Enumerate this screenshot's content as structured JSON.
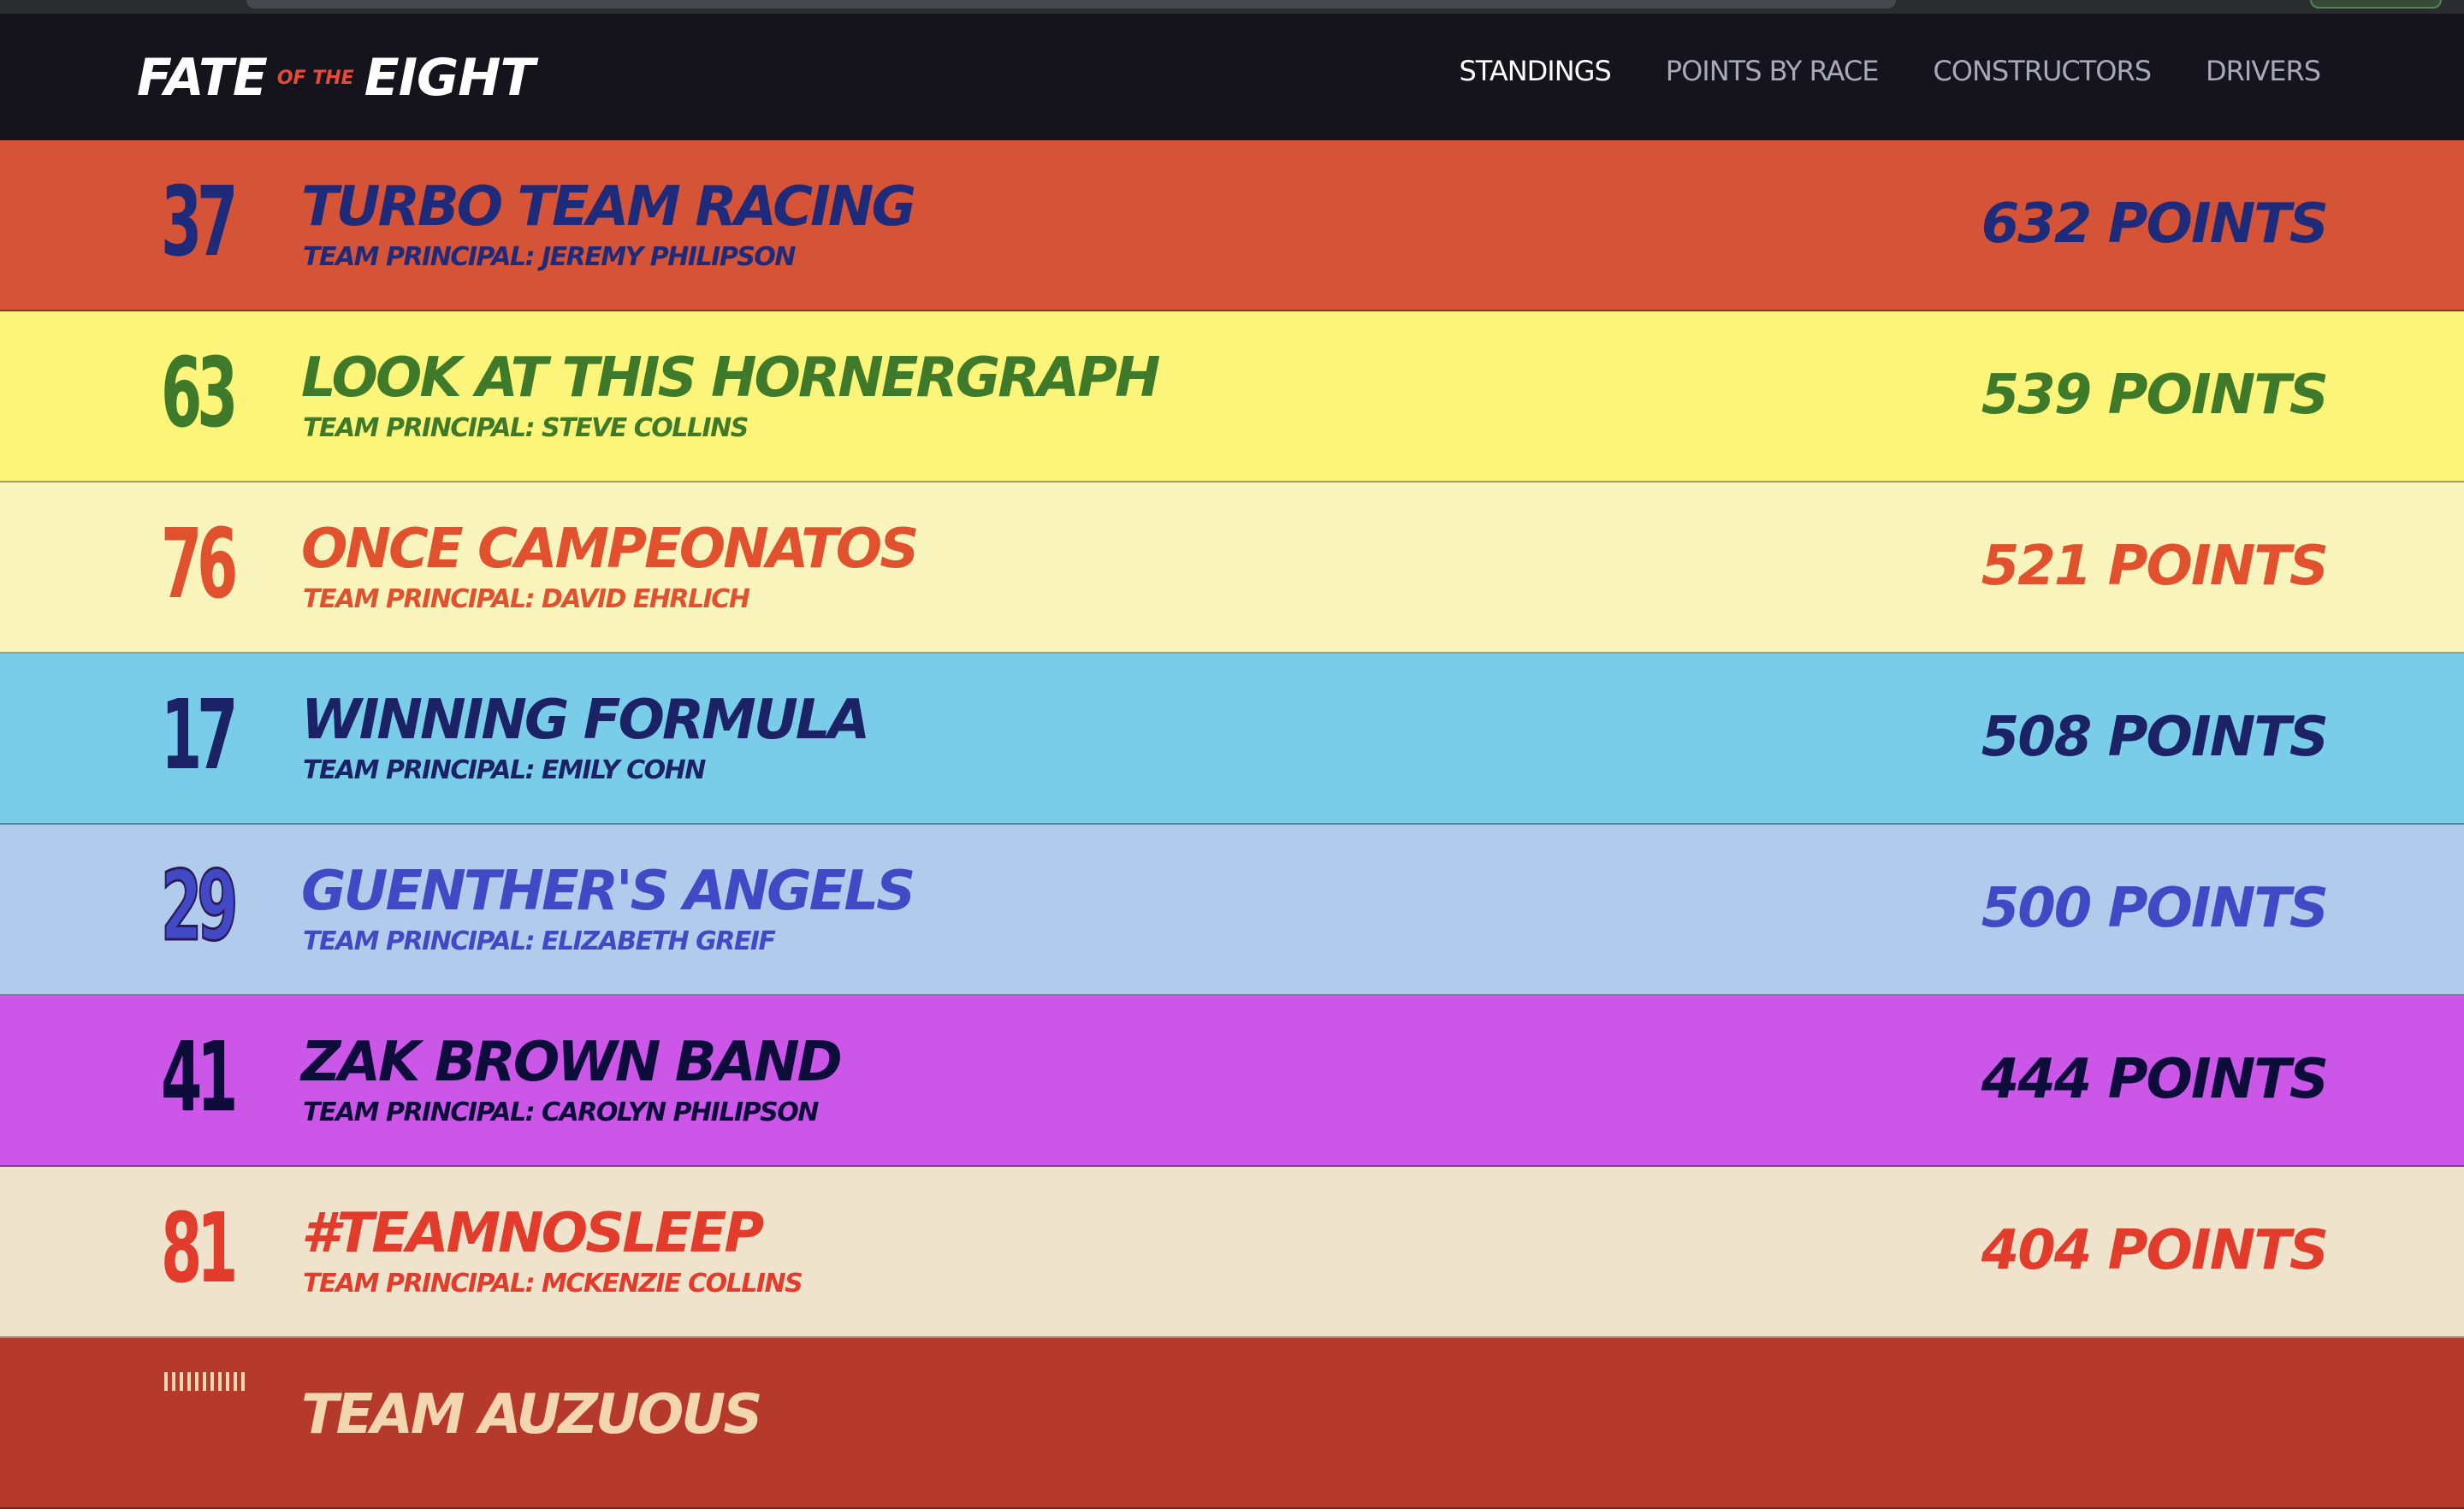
{
  "header": {
    "logo": {
      "word1": "FATE",
      "connector": "OF THE",
      "word2": "EIGHT"
    },
    "nav": [
      {
        "label": "STANDINGS",
        "active": true
      },
      {
        "label": "POINTS BY RACE",
        "active": false
      },
      {
        "label": "CONSTRUCTORS",
        "active": false
      },
      {
        "label": "DRIVERS",
        "active": false
      }
    ]
  },
  "standings": [
    {
      "number": "37",
      "team": "TURBO TEAM RACING",
      "principal": "TEAM PRINCIPAL: JEREMY PHILIPSON",
      "points": "632 POINTS",
      "bg": "#d55336",
      "fg": "#1e2b7a",
      "outline": false
    },
    {
      "number": "63",
      "team": "LOOK AT THIS HORNERGRAPH",
      "principal": "TEAM PRINCIPAL: STEVE COLLINS",
      "points": "539 POINTS",
      "bg": "#fcf57a",
      "fg": "#3e7a2a",
      "outline": false
    },
    {
      "number": "76",
      "team": "ONCE CAMPEONATOS",
      "principal": "TEAM PRINCIPAL: DAVID EHRLICH",
      "points": "521 POINTS",
      "bg": "#f9f3bc",
      "fg": "#e2512e",
      "outline": false
    },
    {
      "number": "17",
      "team": "WINNING FORMULA",
      "principal": "TEAM PRINCIPAL: EMILY COHN",
      "points": "508 POINTS",
      "bg": "#7acde8",
      "fg": "#1c2266",
      "outline": false
    },
    {
      "number": "29",
      "team": "GUENTHER'S ANGELS",
      "principal": "TEAM PRINCIPAL: ELIZABETH GREIF",
      "points": "500 POINTS",
      "bg": "#b0cbeb",
      "fg": "#4149c5",
      "outline": true
    },
    {
      "number": "41",
      "team": "ZAK BROWN BAND",
      "principal": "TEAM PRINCIPAL: CAROLYN PHILIPSON",
      "points": "444 POINTS",
      "bg": "#cb56e8",
      "fg": "#0e0c3a",
      "outline": false
    },
    {
      "number": "81",
      "team": "#TEAMNOSLEEP",
      "principal": "TEAM PRINCIPAL: MCKENZIE COLLINS",
      "points": "404 POINTS",
      "bg": "#f0e3cc",
      "fg": "#e23d2c",
      "outline": false
    },
    {
      "number": "",
      "team": "TEAM AUZUOUS",
      "principal": "",
      "points": "",
      "bg": "#b63a2c",
      "fg": "#f3d6b0",
      "outline": false,
      "partial": true
    }
  ]
}
